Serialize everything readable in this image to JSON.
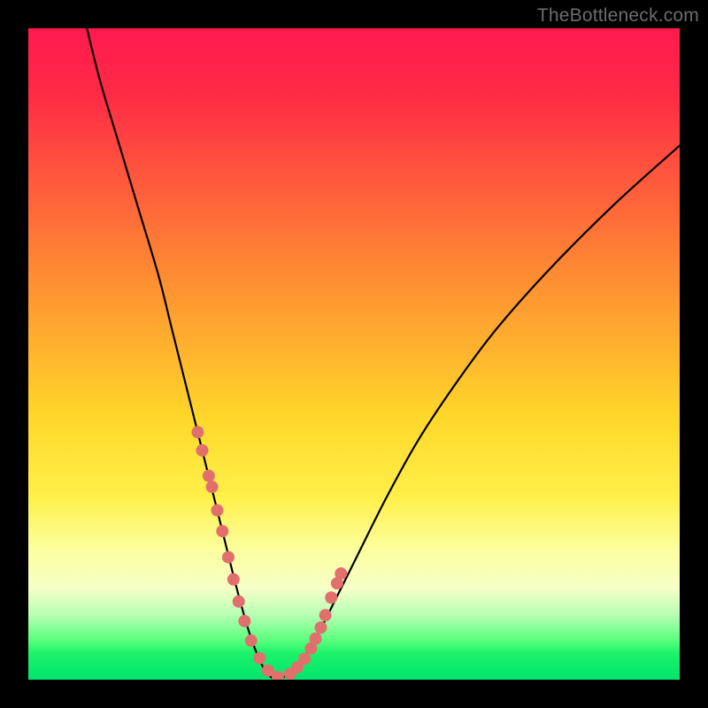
{
  "watermark": {
    "text": "TheBottleneck.com"
  },
  "colors": {
    "top": "#ff1a4f",
    "red": "#ff2a46",
    "orange": "#ff8c32",
    "yellow": "#ffd82a",
    "yellow2": "#fff04a",
    "cream": "#fcff9e",
    "cream2": "#f6ffc7",
    "palegreen": "#b8ffb3",
    "green": "#58ff7e",
    "green2": "#1cf26a",
    "green3": "#00e56e",
    "curve": "#000000",
    "marker": "#e1706d"
  },
  "chart_data": {
    "type": "line",
    "title": "",
    "xlabel": "",
    "ylabel": "",
    "xlim": [
      0,
      100
    ],
    "ylim": [
      0,
      100
    ],
    "grid": false,
    "note": "Heat-gradient background with a V-shaped bottleneck curve. Axis values are not labeled in the image; x and y are normalized 0–100. Curve trough bottoms out at y≈0 around x≈35–40. Markers along the curve near the trough indicate sampled points.",
    "series": [
      {
        "name": "bottleneck-curve",
        "color_ref": "curve",
        "x": [
          9,
          11,
          14,
          17,
          20,
          22,
          24,
          26,
          28,
          30,
          32,
          34,
          36,
          38,
          40,
          42,
          44,
          46,
          50,
          55,
          60,
          66,
          72,
          80,
          90,
          100
        ],
        "y": [
          100,
          92,
          82,
          72,
          62,
          54,
          46,
          38,
          30,
          22,
          14,
          7,
          2,
          0,
          1,
          3,
          6,
          10,
          18,
          28,
          37,
          46,
          54,
          63,
          73,
          82
        ]
      }
    ],
    "markers": {
      "name": "curve-highlight-dots",
      "color_ref": "marker",
      "radius_approx": 1.2,
      "x": [
        26.0,
        26.7,
        27.7,
        28.2,
        29.0,
        29.8,
        30.7,
        31.5,
        32.3,
        33.2,
        34.2,
        35.5,
        36.8,
        38.3,
        40.2,
        41.3,
        42.4,
        43.4,
        44.1,
        44.9,
        45.6,
        46.5,
        47.4,
        48.0
      ],
      "y": [
        38.0,
        35.2,
        31.3,
        29.6,
        26.0,
        22.8,
        18.8,
        15.4,
        12.0,
        9.0,
        6.0,
        3.3,
        1.4,
        0.4,
        0.9,
        1.9,
        3.2,
        4.8,
        6.3,
        8.0,
        9.9,
        12.6,
        14.8,
        16.3
      ]
    },
    "background_zones": [
      {
        "from": 0,
        "to": 10,
        "color_ref": "red"
      },
      {
        "from": 10,
        "to": 38,
        "color_ref": "orange"
      },
      {
        "from": 38,
        "to": 72,
        "color_ref": "yellow"
      },
      {
        "from": 72,
        "to": 86,
        "color_ref": "cream"
      },
      {
        "from": 86,
        "to": 94,
        "color_ref": "palegreen"
      },
      {
        "from": 94,
        "to": 100,
        "color_ref": "green"
      }
    ],
    "legend": null
  }
}
